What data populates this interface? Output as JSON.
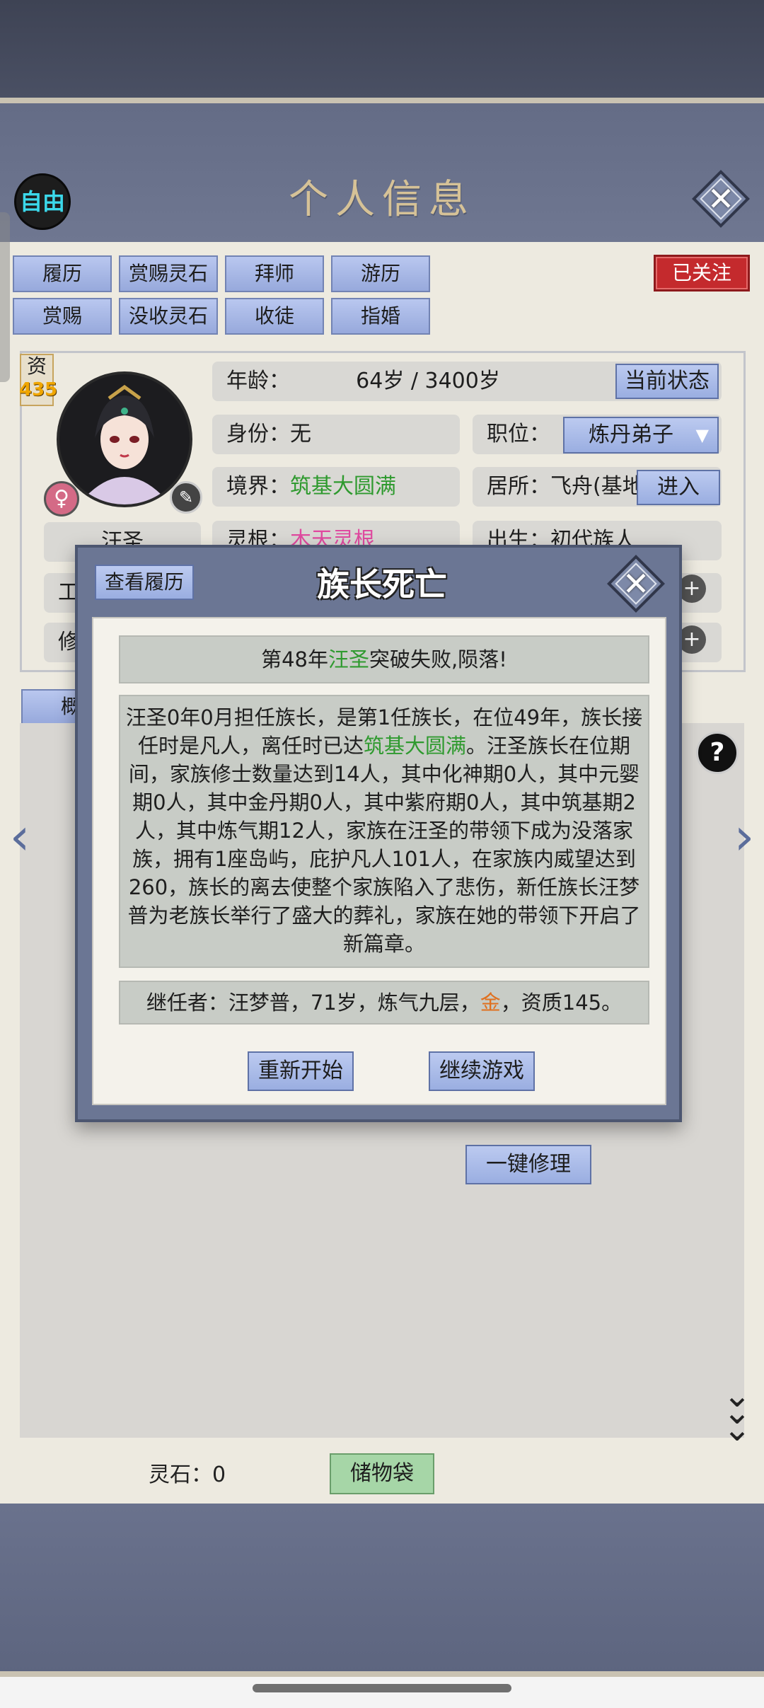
{
  "header": {
    "mode_badge": "自由",
    "title": "个人信息",
    "close_icon": "close-icon"
  },
  "tabs": {
    "row1": [
      "履历",
      "赏赐灵石",
      "拜师",
      "游历"
    ],
    "row2": [
      "赏赐",
      "没收灵石",
      "收徒",
      "指婚"
    ],
    "followed": "已关注"
  },
  "profile": {
    "aptitude_label": "资",
    "aptitude_value": "435",
    "name": "汪圣",
    "age_label": "年龄：",
    "age_value": "64岁 / 3400岁",
    "current_state_button": "当前状态",
    "identity_label": "身份：",
    "identity_value": "无",
    "position_label": "职位：",
    "position_value": "炼丹弟子",
    "realm_label": "境界：",
    "realm_value": "筑基大圆满",
    "residence_label": "居所：",
    "residence_value": "飞舟(基地",
    "enter_button": "进入",
    "root_label": "灵根：",
    "root_value": "木天灵根",
    "birth_label": "出生：",
    "birth_value": "初代族人",
    "row5_label_partial": "工",
    "row6_label_partial": "修",
    "tab_partial": "概"
  },
  "dialog": {
    "history_button": "查看履历",
    "title": "族长死亡",
    "event_prefix": "第48年",
    "event_name": "汪圣",
    "event_suffix": "突破失败,陨落!",
    "story_part1": "汪圣0年0月担任族长，是第1任族长，在位49年，族长接任时是凡人，离任时已达",
    "story_realm": "筑基大圆满",
    "story_part2": "。汪圣族长在位期间，家族修士数量达到14人，其中化神期0人，其中元婴期0人，其中金丹期0人，其中紫府期0人，其中筑基期2人，其中炼气期12人，家族在汪圣的带领下成为没落家族，拥有1座岛屿，庇护凡人101人，在家族内威望达到260，族长的离去使整个家族陷入了悲伤，新任族长汪梦普为老族长举行了盛大的葬礼，家族在她的带领下开启了新篇章。",
    "successor_prefix": "继任者：汪梦普，71岁，炼气九层，",
    "successor_element": "金",
    "successor_suffix": "，资质145。",
    "restart_button": "重新开始",
    "continue_button": "继续游戏"
  },
  "actions": {
    "repair_all": "一键修理"
  },
  "footer": {
    "spirit_stones": "灵石：0",
    "storage_bag": "储物袋"
  },
  "colors": {
    "accent_green": "#2f9a2f",
    "accent_pink": "#e04aa0",
    "accent_orange": "#e0701f",
    "followed_red": "#c42a2d"
  }
}
